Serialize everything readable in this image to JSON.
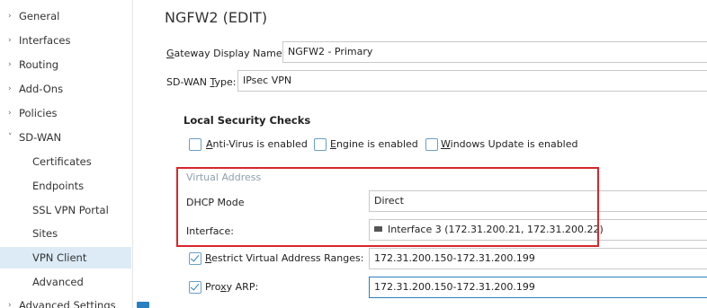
{
  "sidebar": {
    "items": [
      {
        "label": "General",
        "chevron": "›",
        "sub": false,
        "active": false
      },
      {
        "label": "Interfaces",
        "chevron": "›",
        "sub": false,
        "active": false
      },
      {
        "label": "Routing",
        "chevron": "›",
        "sub": false,
        "active": false
      },
      {
        "label": "Add-Ons",
        "chevron": "›",
        "sub": false,
        "active": false
      },
      {
        "label": "Policies",
        "chevron": "›",
        "sub": false,
        "active": false
      },
      {
        "label": "SD-WAN",
        "chevron": "˅",
        "sub": false,
        "active": false
      },
      {
        "label": "Certificates",
        "sub": true,
        "active": false
      },
      {
        "label": "Endpoints",
        "sub": true,
        "active": false
      },
      {
        "label": "SSL VPN Portal",
        "sub": true,
        "active": false
      },
      {
        "label": "Sites",
        "sub": true,
        "active": false
      },
      {
        "label": "VPN Client",
        "sub": true,
        "active": true
      },
      {
        "label": "Advanced",
        "sub": true,
        "active": false
      },
      {
        "label": "Advanced Settings",
        "chevron": "›",
        "sub": false,
        "active": false
      }
    ]
  },
  "main": {
    "title": "NGFW2 (EDIT)",
    "gateway_display_name": {
      "label_prefix": "G",
      "label_rest": "ateway Display Name:",
      "value": "NGFW2 - Primary"
    },
    "sdwan_type": {
      "label_start": "SD-WAN ",
      "label_u": "T",
      "label_rest": "ype:",
      "value": "IPsec VPN"
    },
    "local_security_checks": {
      "title": "Local Security Checks",
      "checks": [
        {
          "u": "A",
          "rest": "nti-Virus is enabled",
          "checked": false
        },
        {
          "u": "E",
          "rest": "ngine is enabled",
          "checked": false
        },
        {
          "u": "W",
          "rest": "indows Update is enabled",
          "checked": false
        }
      ]
    },
    "virtual_address": {
      "legend": "Virtual Address",
      "dhcp_mode": {
        "label": "DHCP Mode",
        "value": "Direct"
      },
      "interface": {
        "label": "Interface:",
        "value": "Interface 3 (172.31.200.21, 172.31.200.22)",
        "icon": "network-interface-icon"
      }
    },
    "restrict_ranges": {
      "u": "R",
      "rest": "estrict Virtual Address Ranges:",
      "checked": true,
      "value": "172.31.200.150-172.31.200.199"
    },
    "proxy_arp": {
      "start": "Pro",
      "u": "x",
      "rest": "y ARP:",
      "checked": true,
      "value": "172.31.200.150-172.31.200.199"
    }
  },
  "colors": {
    "highlight": "#d7262b",
    "accent": "#2a7fc1",
    "active_nav": "#dcebf6"
  }
}
